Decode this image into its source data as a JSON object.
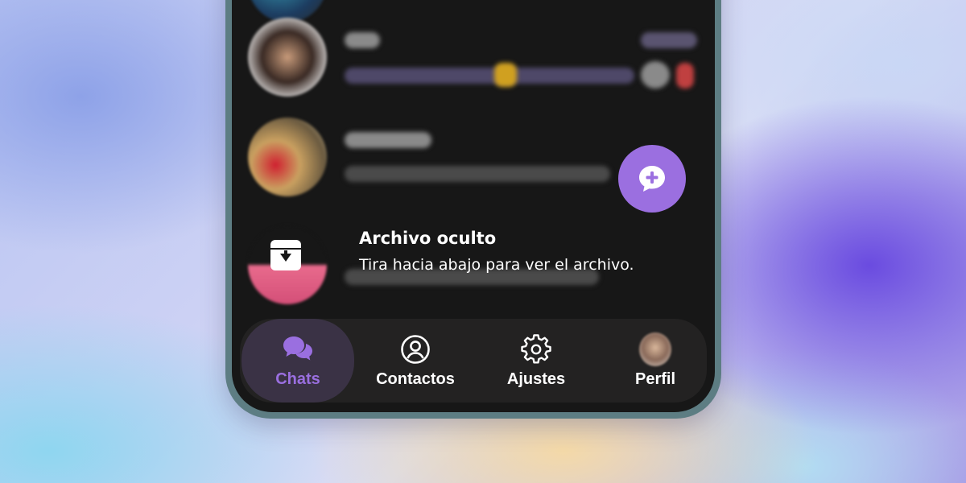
{
  "archive_toast": {
    "title": "Archivo oculto",
    "subtitle": "Tira hacia abajo para ver el archivo."
  },
  "fab": {
    "icon": "new-chat-icon",
    "color": "#9b6fe0"
  },
  "bottom_nav": {
    "items": [
      {
        "label": "Chats",
        "icon": "chat-bubbles-icon",
        "active": true
      },
      {
        "label": "Contactos",
        "icon": "contact-icon",
        "active": false
      },
      {
        "label": "Ajustes",
        "icon": "gear-icon",
        "active": false
      },
      {
        "label": "Perfil",
        "icon": "avatar",
        "active": false
      }
    ],
    "active_color": "#9a6fe0"
  }
}
